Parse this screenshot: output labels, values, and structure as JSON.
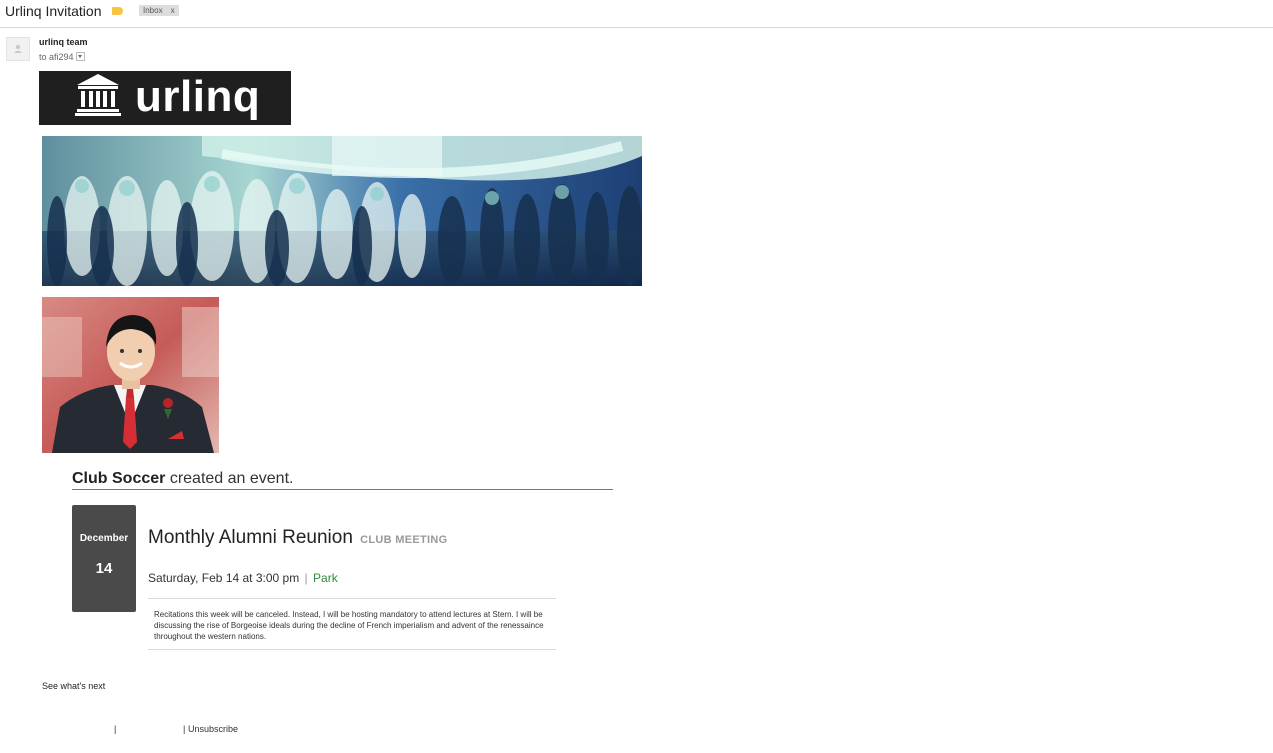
{
  "email": {
    "subject": "Urlinq Invitation",
    "label_chip": "Inbox",
    "label_chip_close": "x",
    "sender_name": "urlinq team",
    "recipient_prefix": "to",
    "recipient": "afi294"
  },
  "newsletter": {
    "logo_text": "urlinq",
    "creator_name": "Club Soccer",
    "creator_action": "created an event.",
    "event": {
      "month": "December",
      "day": "14",
      "title": "Monthly Alumni Reunion",
      "type": "CLUB MEETING",
      "when": "Saturday, Feb 14 at 3:00 pm",
      "separator": "|",
      "location": "Park",
      "description": "Recitations this week will be canceled. Instead, I will be hosting mandatory to attend lectures at Stern. I will be discussing the rise of Borgeoise ideals during the decline of French imperialism and advent of the renessaince throughout the western nations."
    },
    "see_next": "See what's next",
    "footer_pipe": "|",
    "unsubscribe": "Unsubscribe"
  },
  "colors": {
    "label_yellow": "#f6c343",
    "logo_bg": "#1f1f1f",
    "date_box": "#4a4a4a",
    "location_green": "#2e8b3a"
  }
}
